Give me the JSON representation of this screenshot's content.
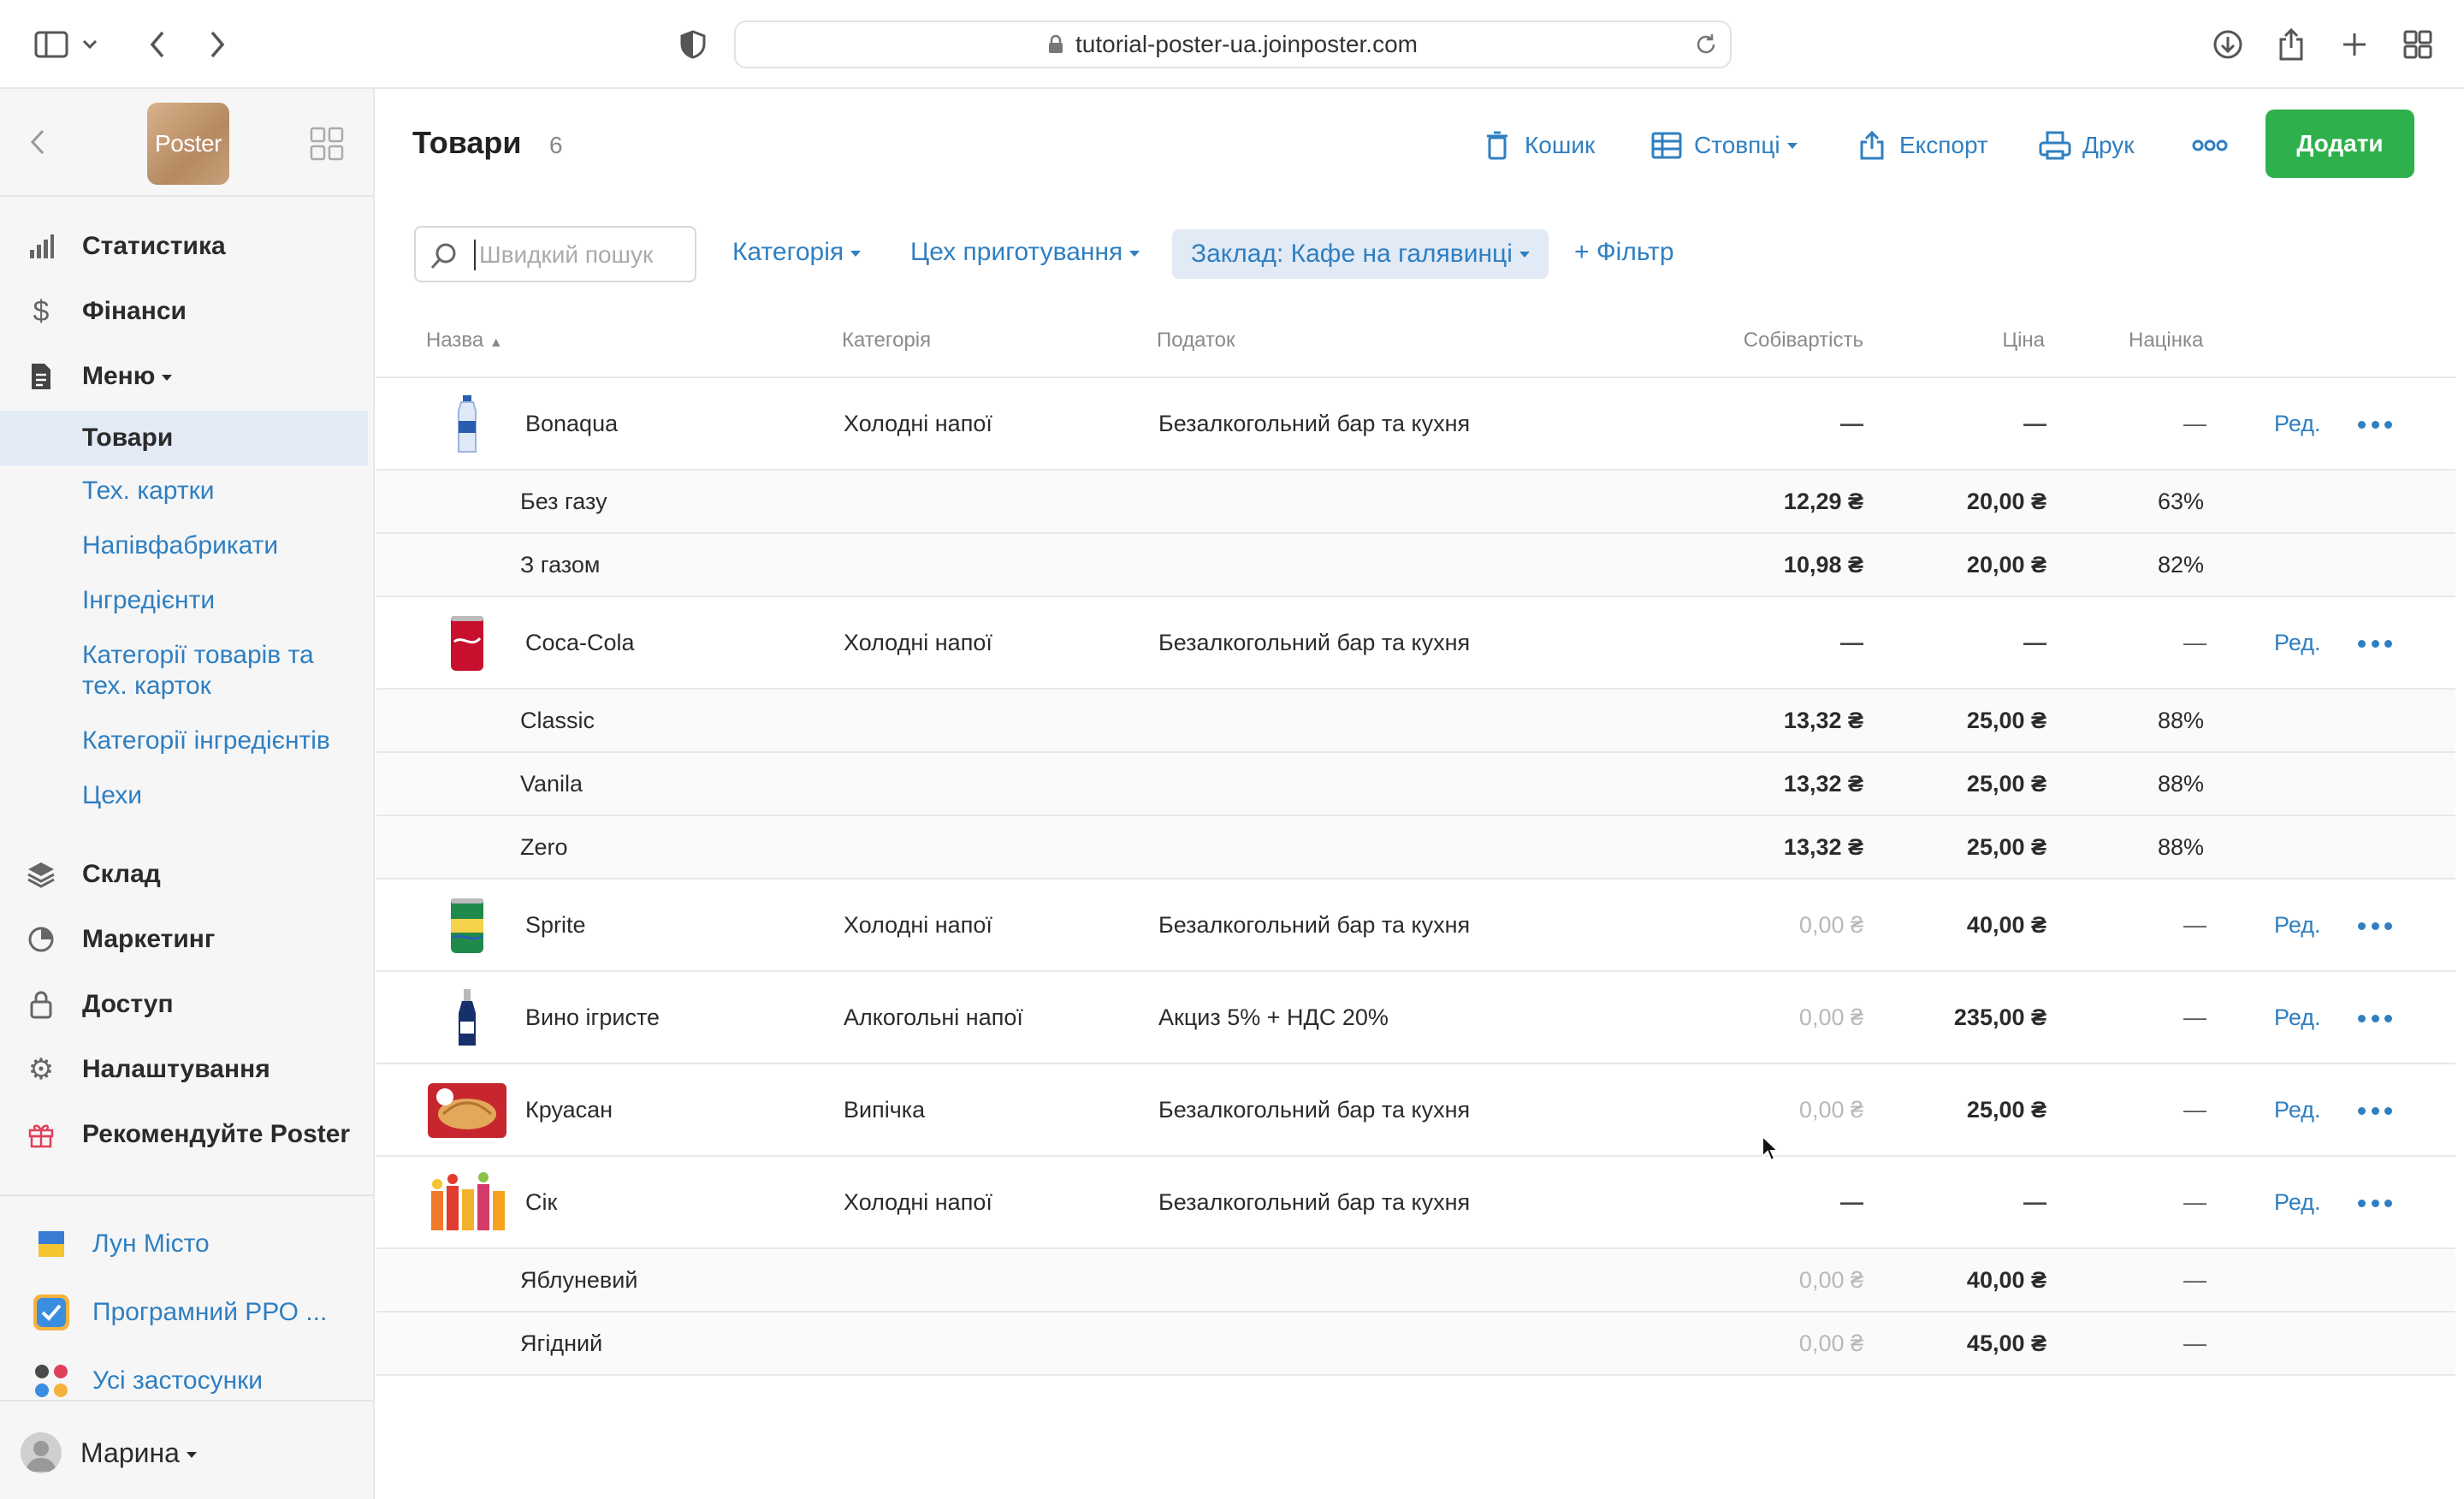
{
  "browser": {
    "url": "tutorial-poster-ua.joinposter.com"
  },
  "sidebar": {
    "logo_text": "Poster",
    "nav": [
      {
        "label": "Статистика",
        "icon": "bar-chart-icon"
      },
      {
        "label": "Фінанси",
        "icon": "dollar-icon"
      },
      {
        "label": "Меню",
        "icon": "document-icon"
      }
    ],
    "menu_sub": [
      {
        "label": "Товари",
        "active": true
      },
      {
        "label": "Тех. картки"
      },
      {
        "label": "Напівфабрикати"
      },
      {
        "label": "Інгредієнти"
      },
      {
        "label": "Категорії товарів та тех. карток"
      },
      {
        "label": "Категорії інгредієнтів"
      },
      {
        "label": "Цехи"
      }
    ],
    "nav2": [
      {
        "label": "Склад",
        "icon": "layers-icon"
      },
      {
        "label": "Маркетинг",
        "icon": "pie-chart-icon"
      },
      {
        "label": "Доступ",
        "icon": "lock-icon"
      },
      {
        "label": "Налаштування",
        "icon": "gear-icon"
      },
      {
        "label": "Рекомендуйте Poster",
        "icon": "gift-icon"
      }
    ],
    "apps": [
      {
        "label": "Лун Місто",
        "icon": "ukraine-flag-icon"
      },
      {
        "label": "Програмний РРО ...",
        "icon": "checkbox-app-icon"
      },
      {
        "label": "Усі застосунки",
        "icon": "apps-grid-icon"
      }
    ],
    "user": "Марина"
  },
  "header": {
    "title": "Товари",
    "count": "6",
    "toolbar": {
      "trash": "Кошик",
      "columns": "Стовпці",
      "export": "Експорт",
      "print": "Друк",
      "add": "Додати"
    }
  },
  "filters": {
    "search_placeholder": "Швидкий пошук",
    "category": "Категорія",
    "workshop": "Цех приготування",
    "venue": "Заклад: Кафе на галявинці",
    "add_filter": "+ Фільтр"
  },
  "table": {
    "headers": {
      "name": "Назва",
      "category": "Категорія",
      "tax": "Податок",
      "cost": "Собівартість",
      "price": "Ціна",
      "markup": "Націнка"
    },
    "edit_label": "Ред.",
    "rows": [
      {
        "type": "product",
        "name": "Bonaqua",
        "category": "Холодні напої",
        "tax": "Безалкогольний бар та кухня",
        "cost": "—",
        "price": "—",
        "markup": "—",
        "thumb": "bottle-water"
      },
      {
        "type": "variant",
        "name": "Без газу",
        "cost": "12,29 ₴",
        "price": "20,00 ₴",
        "markup": "63%"
      },
      {
        "type": "variant",
        "name": "З газом",
        "cost": "10,98 ₴",
        "price": "20,00 ₴",
        "markup": "82%"
      },
      {
        "type": "product",
        "name": "Coca-Cola",
        "category": "Холодні напої",
        "tax": "Безалкогольний бар та кухня",
        "cost": "—",
        "price": "—",
        "markup": "—",
        "thumb": "can-red"
      },
      {
        "type": "variant",
        "name": "Classic",
        "cost": "13,32 ₴",
        "price": "25,00 ₴",
        "markup": "88%"
      },
      {
        "type": "variant",
        "name": "Vanila",
        "cost": "13,32 ₴",
        "price": "25,00 ₴",
        "markup": "88%"
      },
      {
        "type": "variant",
        "name": "Zero",
        "cost": "13,32 ₴",
        "price": "25,00 ₴",
        "markup": "88%"
      },
      {
        "type": "product",
        "name": "Sprite",
        "category": "Холодні напої",
        "tax": "Безалкогольний бар та кухня",
        "cost": "0,00 ₴",
        "price": "40,00 ₴",
        "markup": "—",
        "thumb": "can-green"
      },
      {
        "type": "product",
        "name": "Вино ігристе",
        "category": "Алкогольні напої",
        "tax": "Акциз 5% + НДС 20%",
        "cost": "0,00 ₴",
        "price": "235,00 ₴",
        "markup": "—",
        "thumb": "bottle-wine"
      },
      {
        "type": "product",
        "name": "Круасан",
        "category": "Випічка",
        "tax": "Безалкогольний бар та кухня",
        "cost": "0,00 ₴",
        "price": "25,00 ₴",
        "markup": "—",
        "thumb": "croissant"
      },
      {
        "type": "product",
        "name": "Сік",
        "category": "Холодні напої",
        "tax": "Безалкогольний бар та кухня",
        "cost": "—",
        "price": "—",
        "markup": "—",
        "thumb": "juices"
      },
      {
        "type": "variant",
        "name": "Яблуневий",
        "cost": "0,00 ₴",
        "price": "40,00 ₴",
        "markup": "—"
      },
      {
        "type": "variant",
        "name": "Ягідний",
        "cost": "0,00 ₴",
        "price": "45,00 ₴",
        "markup": "—"
      }
    ]
  },
  "colors": {
    "accent": "#2f7fc1",
    "add_button": "#2eb14c",
    "active_nav_bg": "#e1eaf5"
  }
}
